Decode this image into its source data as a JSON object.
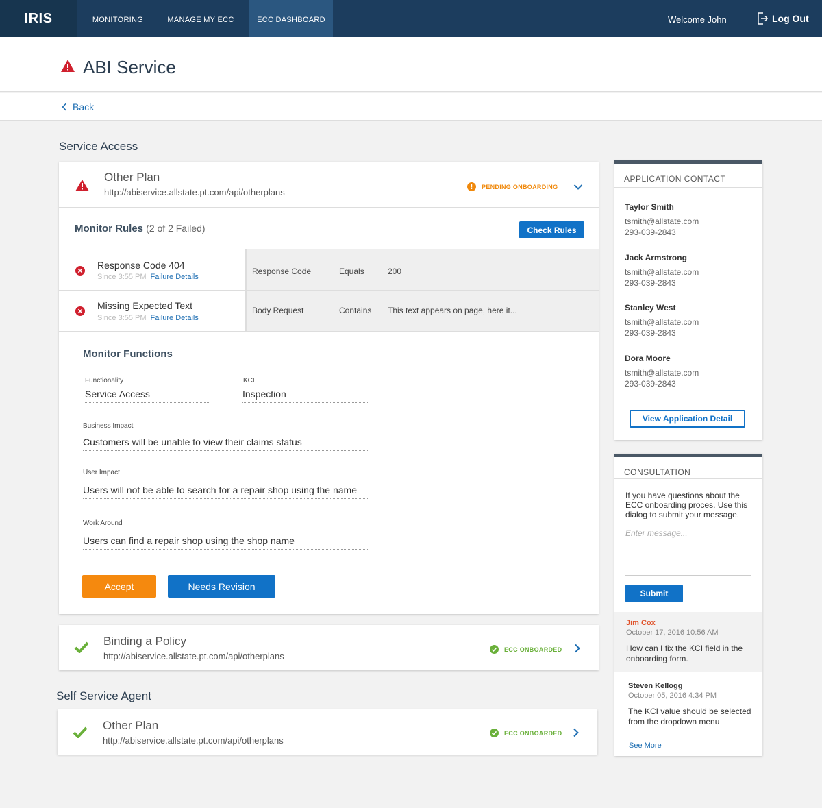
{
  "nav": {
    "logo": "IRIS",
    "items": [
      {
        "label": "MONITORING"
      },
      {
        "label": "MANAGE MY ECC"
      },
      {
        "label": "ECC DASHBOARD"
      }
    ],
    "welcome": "Welcome John",
    "logout": "Log Out"
  },
  "page": {
    "title": "ABI Service",
    "back": "Back"
  },
  "service_access": {
    "heading": "Service Access",
    "plan": {
      "name": "Other Plan",
      "url": "http://abiservice.allstate.pt.com/api/otherplans",
      "status": "PENDING ONBOARDING"
    },
    "rules": {
      "title": "Monitor Rules",
      "count": "(2 of 2 Failed)",
      "check_button": "Check Rules",
      "items": [
        {
          "name": "Response Code 404",
          "since": "Since 3:55 PM",
          "link": "Failure Details",
          "field": "Response Code",
          "op": "Equals",
          "value": "200"
        },
        {
          "name": "Missing Expected Text",
          "since": "Since 3:55 PM",
          "link": "Failure Details",
          "field": "Body Request",
          "op": "Contains",
          "value": "This text appears on page, here it..."
        }
      ]
    },
    "functions": {
      "title": "Monitor Functions",
      "functionality_label": "Functionality",
      "functionality_value": "Service Access",
      "kci_label": "KCI",
      "kci_value": "Inspection",
      "business_label": "Business Impact",
      "business_value": "Customers will be unable to view their claims status",
      "user_label": "User Impact",
      "user_value": "Users will not be able to search for a repair shop using the name",
      "work_label": "Work Around",
      "work_value": "Users can find a repair shop using the shop name",
      "accept": "Accept",
      "revision": "Needs Revision"
    },
    "binding": {
      "name": "Binding a Policy",
      "url": "http://abiservice.allstate.pt.com/api/otherplans",
      "status": "ECC ONBOARDED"
    }
  },
  "self_service": {
    "heading": "Self Service Agent",
    "plan": {
      "name": "Other Plan",
      "url": "http://abiservice.allstate.pt.com/api/otherplans",
      "status": "ECC ONBOARDED"
    }
  },
  "contacts": {
    "title": "APPLICATION CONTACT",
    "people": [
      {
        "name": "Taylor Smith",
        "email": "tsmith@allstate.com",
        "phone": "293-039-2843"
      },
      {
        "name": "Jack Armstrong",
        "email": "tsmith@allstate.com",
        "phone": "293-039-2843"
      },
      {
        "name": "Stanley West",
        "email": "tsmith@allstate.com",
        "phone": "293-039-2843"
      },
      {
        "name": "Dora Moore",
        "email": "tsmith@allstate.com",
        "phone": "293-039-2843"
      }
    ],
    "button": "View Application Detail"
  },
  "consultation": {
    "title": "CONSULTATION",
    "text": "If you have questions about the ECC onboarding proces. Use this dialog to submit your message.",
    "placeholder": "Enter message...",
    "submit": "Submit",
    "messages": [
      {
        "author": "Jim Cox",
        "date": "October 17, 2016 10:56 AM",
        "body": "How can I fix the KCI field in the onboarding form."
      },
      {
        "author": "Steven Kellogg",
        "date": "October 05, 2016  4:34 PM",
        "body": "The KCI value should be selected from the dropdown menu"
      }
    ],
    "see_more": "See More"
  },
  "colors": {
    "nav_bg": "#1c3d5e",
    "primary": "#1172c7",
    "warning": "#d0202e",
    "pending": "#f0890c",
    "success": "#6ab03a"
  }
}
